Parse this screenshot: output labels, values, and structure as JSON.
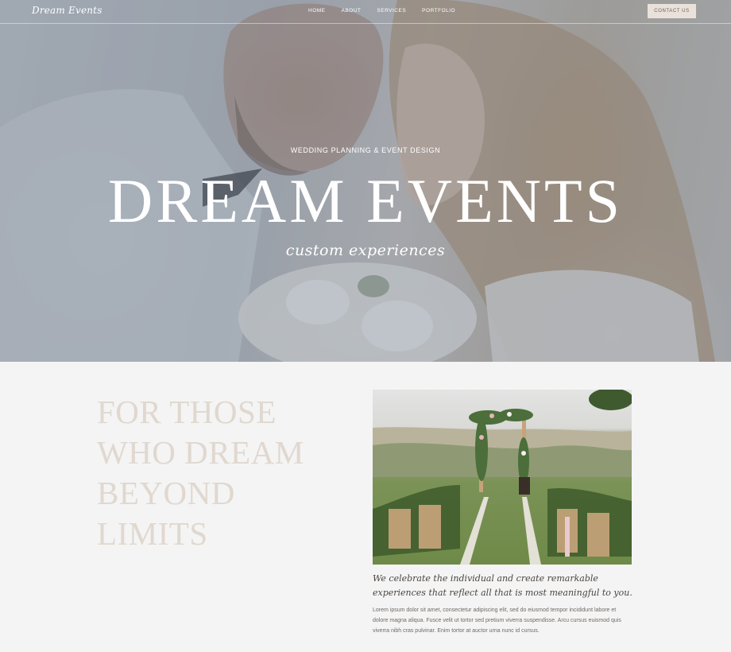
{
  "header": {
    "logo": "Dream Events",
    "nav": [
      "HOME",
      "ABOUT",
      "SERVICES",
      "PORTFOLIO"
    ],
    "contact_label": "CONTACT US"
  },
  "hero": {
    "kicker": "WEDDING PLANNING & EVENT DESIGN",
    "title": "DREAM EVENTS",
    "script": "custom experiences"
  },
  "intro": {
    "tagline_lines": [
      "FOR THOSE",
      "WHO DREAM",
      "BEYOND",
      "LIMITS"
    ],
    "quote": "We celebrate the individual and create remarkable experiences that reflect all that is most meaningful to you.",
    "body": "Lorem ipsum dolor sit amet, consectetur adipiscing elit, sed do eiusmod tempor incididunt labore et dolore magna aliqua. Fusce velit ut tortor sed pretium viverra suspendisse. Arcu cursus euismod quis viverra nibh cras pulvinar. Enim tortor at auctor urna nunc id cursus."
  },
  "icons": {
    "hero_photo": "couple-photo",
    "ceremony_photo": "ceremony-arch-photo"
  },
  "colors": {
    "tagline": "#e0d8cf",
    "contact_button_bg": "#e9e1da",
    "page_bg": "#f4f4f4"
  }
}
